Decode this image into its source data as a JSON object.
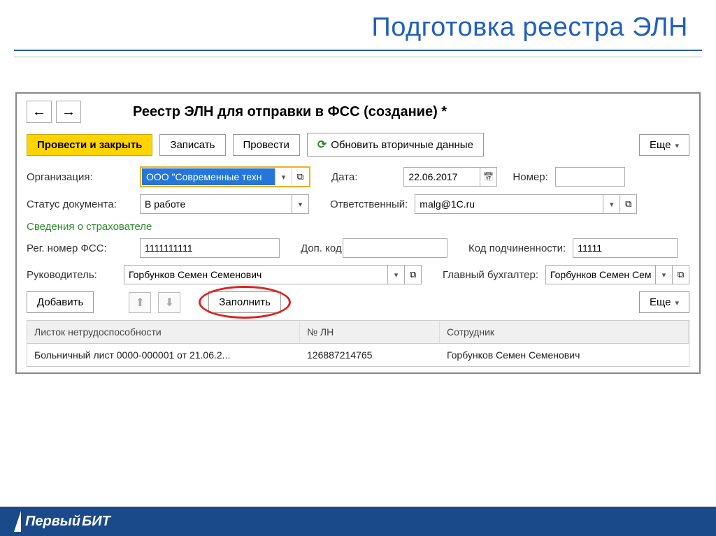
{
  "slide": {
    "title": "Подготовка реестра ЭЛН"
  },
  "nav": {
    "back": "←",
    "forward": "→"
  },
  "window": {
    "title": "Реестр ЭЛН для отправки в ФСС (создание) *"
  },
  "toolbar": {
    "post_close": "Провести и закрыть",
    "write": "Записать",
    "post": "Провести",
    "refresh": "Обновить вторичные данные",
    "more": "Еще"
  },
  "form": {
    "org_label": "Организация:",
    "org_value": "ООО \"Современные техн",
    "date_label": "Дата:",
    "date_value": "22.06.2017",
    "number_label": "Номер:",
    "number_value": "",
    "status_label": "Статус документа:",
    "status_value": "В работе",
    "resp_label": "Ответственный:",
    "resp_value": "malg@1C.ru"
  },
  "section": {
    "insurer": "Сведения о страхователе"
  },
  "insurer": {
    "reg_label": "Рег. номер ФСС:",
    "reg_value": "1111111111",
    "dop_label": "Доп. код:",
    "dop_value": "",
    "sub_label": "Код подчиненности:",
    "sub_value": "11111",
    "head_label": "Руководитель:",
    "head_value": "Горбунков Семен Семенович",
    "acct_label": "Главный бухгалтер:",
    "acct_value": "Горбунков Семен Сем"
  },
  "list_toolbar": {
    "add": "Добавить",
    "fill": "Заполнить",
    "more": "Еще"
  },
  "table": {
    "col1": "Листок нетрудоспособности",
    "col2": "№ ЛН",
    "col3": "Сотрудник",
    "rows": [
      {
        "c1": "Больничный лист 0000-000001 от 21.06.2...",
        "c2": "126887214765",
        "c3": "Горбунков Семен Семенович"
      }
    ]
  },
  "footer": {
    "brand1": "Первый",
    "brand2": "БИТ"
  }
}
